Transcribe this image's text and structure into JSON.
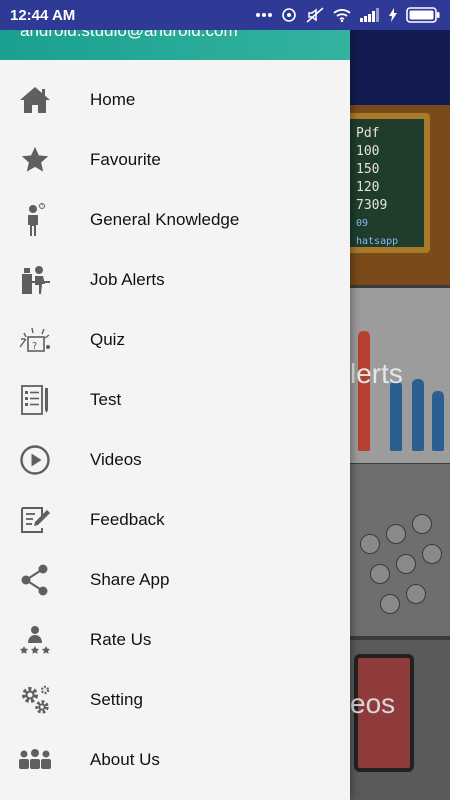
{
  "status_bar": {
    "time": "12:44 AM"
  },
  "drawer": {
    "header_email": "android.studio@android.com",
    "menu_items": [
      {
        "label": "Home",
        "icon": "home-icon"
      },
      {
        "label": "Favourite",
        "icon": "star-icon"
      },
      {
        "label": "General Knowledge",
        "icon": "thinking-person-icon"
      },
      {
        "label": "Job Alerts",
        "icon": "worker-desk-icon"
      },
      {
        "label": "Quiz",
        "icon": "quiz-icon"
      },
      {
        "label": "Test",
        "icon": "test-sheet-icon"
      },
      {
        "label": "Videos",
        "icon": "play-circle-icon"
      },
      {
        "label": "Feedback",
        "icon": "feedback-icon"
      },
      {
        "label": "Share App",
        "icon": "share-icon"
      },
      {
        "label": "Rate Us",
        "icon": "rate-us-icon"
      },
      {
        "label": "Setting",
        "icon": "gears-icon"
      },
      {
        "label": "About Us",
        "icon": "people-group-icon"
      }
    ]
  },
  "background": {
    "card1_lines": [
      "Pdf",
      "100",
      "150",
      "120",
      "7309",
      "09",
      "hatsapp"
    ],
    "card2_text": "lerts",
    "card4_text": "eos"
  },
  "colors": {
    "status_bar": "#2f3a97",
    "drawer_header": "#1ba08f",
    "drawer_bg": "#f4f4f4",
    "icon_gray": "#5f5f5f"
  }
}
